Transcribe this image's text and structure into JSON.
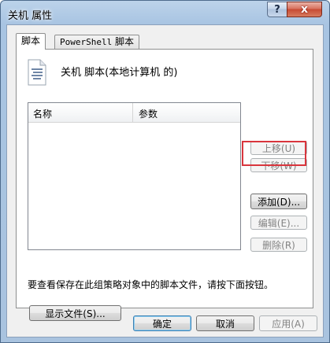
{
  "window": {
    "title": "关机 属性",
    "help_label": "?",
    "close_label": "x"
  },
  "tabs": [
    {
      "label": "脚本",
      "active": true
    },
    {
      "label_prefix": "PowerShell",
      "label_suffix": " 脚本",
      "active": false
    }
  ],
  "scripts_panel": {
    "icon": "script-document-icon",
    "title": "关机 脚本(本地计算机 的)",
    "list": {
      "columns": [
        "名称",
        "参数"
      ],
      "rows": []
    },
    "buttons": {
      "move_up": "上移(U)",
      "move_down": "下移(W)",
      "add": "添加(D)...",
      "edit": "编辑(E)...",
      "delete": "删除(R)"
    },
    "hint": "要查看保存在此组策略对象中的脚本文件，请按下面按钮。",
    "show_files": "显示文件(S)..."
  },
  "footer": {
    "ok": "确定",
    "cancel": "取消",
    "apply": "应用(A)"
  },
  "colors": {
    "highlight_border": "#d9353d",
    "titlebar": "#a9c3df"
  }
}
